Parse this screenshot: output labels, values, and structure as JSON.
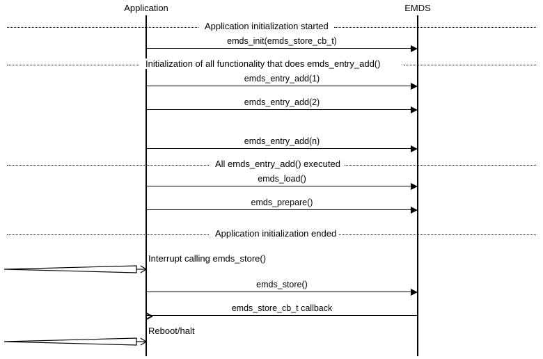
{
  "participants": {
    "left": "Application",
    "right": "EMDS"
  },
  "dividers": {
    "d1": "Application initialization started",
    "d2": "Initialization of all functionality that does emds_entry_add()",
    "d3": "All emds_entry_add() executed",
    "d4": "Application initialization ended"
  },
  "messages": {
    "m_init": "emds_init(emds_store_cb_t)",
    "m_add1": "emds_entry_add(1)",
    "m_add2": "emds_entry_add(2)",
    "m_addn": "emds_entry_add(n)",
    "m_load": "emds_load()",
    "m_prepare": "emds_prepare()",
    "m_store": "emds_store()",
    "m_cb": "emds_store_cb_t callback"
  },
  "notes": {
    "interrupt": "Interrupt calling emds_store()",
    "reboot": "Reboot/halt"
  },
  "chart_data": {
    "type": "sequence-diagram",
    "participants": [
      "Application",
      "EMDS"
    ],
    "events": [
      {
        "type": "divider",
        "text": "Application initialization started"
      },
      {
        "type": "message",
        "from": "Application",
        "to": "EMDS",
        "text": "emds_init(emds_store_cb_t)"
      },
      {
        "type": "divider",
        "text": "Initialization of all functionality that does emds_entry_add()"
      },
      {
        "type": "message",
        "from": "Application",
        "to": "EMDS",
        "text": "emds_entry_add(1)"
      },
      {
        "type": "message",
        "from": "Application",
        "to": "EMDS",
        "text": "emds_entry_add(2)"
      },
      {
        "type": "message",
        "from": "Application",
        "to": "EMDS",
        "text": "emds_entry_add(n)"
      },
      {
        "type": "divider",
        "text": "All emds_entry_add() executed"
      },
      {
        "type": "message",
        "from": "Application",
        "to": "EMDS",
        "text": "emds_load()"
      },
      {
        "type": "message",
        "from": "Application",
        "to": "EMDS",
        "text": "emds_prepare()"
      },
      {
        "type": "divider",
        "text": "Application initialization ended"
      },
      {
        "type": "external",
        "to": "Application",
        "text": "Interrupt calling emds_store()"
      },
      {
        "type": "message",
        "from": "Application",
        "to": "EMDS",
        "text": "emds_store()"
      },
      {
        "type": "message",
        "from": "EMDS",
        "to": "Application",
        "text": "emds_store_cb_t callback",
        "return": true
      },
      {
        "type": "external",
        "to": "Application",
        "text": "Reboot/halt"
      }
    ]
  }
}
